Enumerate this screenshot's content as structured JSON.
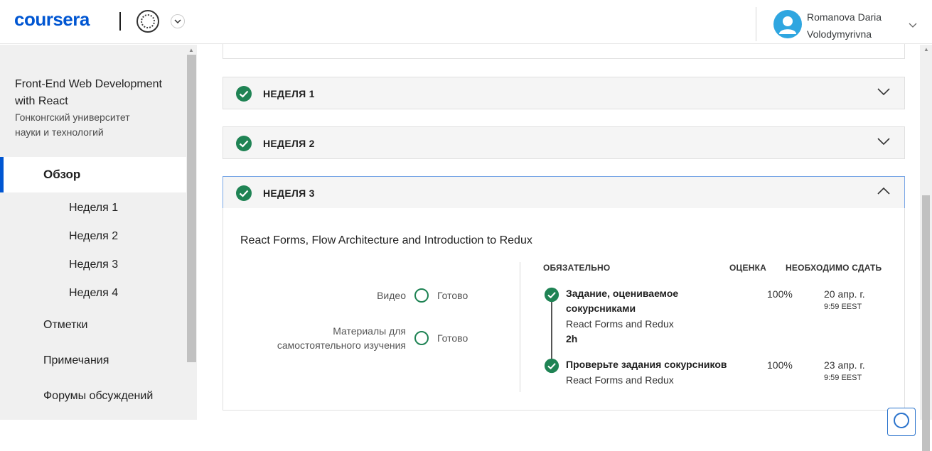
{
  "header": {
    "logo_text": "coursera",
    "user_name_line1": "Romanova Daria",
    "user_name_line2": "Volodymyrivna"
  },
  "sidebar": {
    "course_title": "Front-End Web Development with React",
    "course_org": "Гонконгский университет науки и технологий",
    "active_item": "Обзор",
    "weeks": [
      "Неделя 1",
      "Неделя 2",
      "Неделя 3",
      "Неделя 4"
    ],
    "items": [
      "Отметки",
      "Примечания",
      "Форумы обсуждений"
    ]
  },
  "main": {
    "weeks": [
      {
        "label": "НЕДЕЛЯ 1"
      },
      {
        "label": "НЕДЕЛЯ 2"
      },
      {
        "label": "НЕДЕЛЯ 3"
      }
    ],
    "open_week": {
      "description": "React Forms, Flow Architecture and Introduction to Redux",
      "progress": [
        {
          "label": "Видео",
          "status": "Готово"
        },
        {
          "label": "Материалы для самостоятельного изучения",
          "status": "Готово"
        }
      ],
      "columns": {
        "required": "ОБЯЗАТЕЛЬНО",
        "grade": "ОЦЕНКА",
        "due": "НЕОБХОДИМО СДАТЬ"
      },
      "items": [
        {
          "title": "Задание, оцениваемое сокурсниками",
          "subtitle": "React Forms and Redux",
          "duration": "2h",
          "grade": "100%",
          "due_date": "20 апр. г.",
          "due_time": "9:59 EEST"
        },
        {
          "title": "Проверьте задания сокурсников",
          "subtitle": "React Forms and Redux",
          "grade": "100%",
          "due_date": "23 апр. г.",
          "due_time": "9:59 EEST"
        }
      ]
    }
  },
  "colors": {
    "brand_blue": "#0056d2",
    "check_green": "#1f8354",
    "avatar_blue": "#2fa6e0"
  }
}
